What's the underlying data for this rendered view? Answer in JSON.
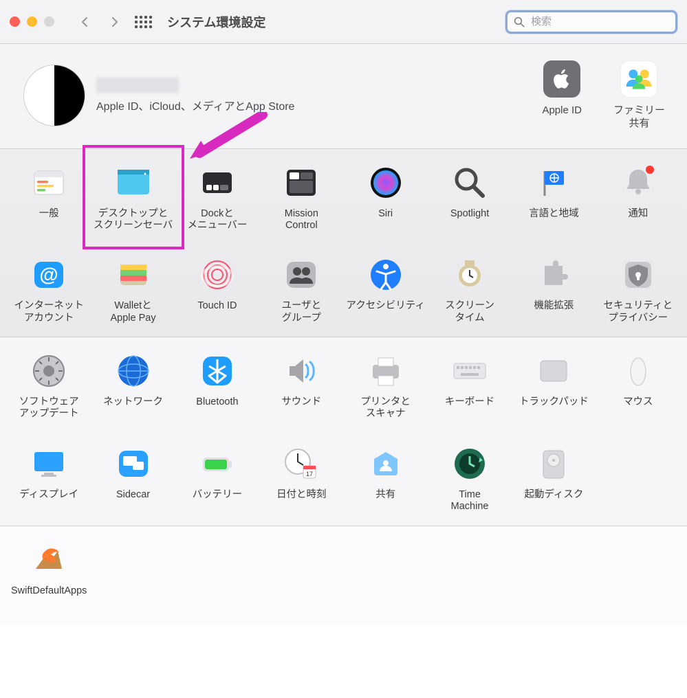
{
  "toolbar": {
    "title": "システム環境設定",
    "search_placeholder": "検索"
  },
  "header": {
    "subtitle": "Apple ID、iCloud、メディアとApp Store",
    "apple_id_label": "Apple ID",
    "family_label": "ファミリー\n共有"
  },
  "rows": {
    "a": [
      {
        "id": "general",
        "label": "一般"
      },
      {
        "id": "desktop",
        "label": "デスクトップと\nスクリーンセーバ"
      },
      {
        "id": "dock",
        "label": "Dockと\nメニューバー"
      },
      {
        "id": "mission",
        "label": "Mission\nControl"
      },
      {
        "id": "siri",
        "label": "Siri"
      },
      {
        "id": "spotlight",
        "label": "Spotlight"
      },
      {
        "id": "lang",
        "label": "言語と地域"
      },
      {
        "id": "notif",
        "label": "通知"
      },
      {
        "id": "internet",
        "label": "インターネット\nアカウント"
      },
      {
        "id": "wallet",
        "label": "Walletと\nApple Pay"
      },
      {
        "id": "touchid",
        "label": "Touch ID"
      },
      {
        "id": "users",
        "label": "ユーザと\nグループ"
      },
      {
        "id": "a11y",
        "label": "アクセシビリティ"
      },
      {
        "id": "screentime",
        "label": "スクリーン\nタイム"
      },
      {
        "id": "ext",
        "label": "機能拡張"
      },
      {
        "id": "security",
        "label": "セキュリティと\nプライバシー"
      }
    ],
    "b": [
      {
        "id": "swupdate",
        "label": "ソフトウェア\nアップデート"
      },
      {
        "id": "network",
        "label": "ネットワーク"
      },
      {
        "id": "bluetooth",
        "label": "Bluetooth"
      },
      {
        "id": "sound",
        "label": "サウンド"
      },
      {
        "id": "print",
        "label": "プリンタと\nスキャナ"
      },
      {
        "id": "keyboard",
        "label": "キーボード"
      },
      {
        "id": "trackpad",
        "label": "トラックパッド"
      },
      {
        "id": "mouse",
        "label": "マウス"
      },
      {
        "id": "display",
        "label": "ディスプレイ"
      },
      {
        "id": "sidecar",
        "label": "Sidecar"
      },
      {
        "id": "battery",
        "label": "バッテリー"
      },
      {
        "id": "datetime",
        "label": "日付と時刻"
      },
      {
        "id": "sharing",
        "label": "共有"
      },
      {
        "id": "timemachine",
        "label": "Time\nMachine"
      },
      {
        "id": "startup",
        "label": "起動ディスク"
      }
    ],
    "c": [
      {
        "id": "swiftdefault",
        "label": "SwiftDefaultApps"
      }
    ]
  },
  "annotation": {
    "target": "desktop"
  }
}
